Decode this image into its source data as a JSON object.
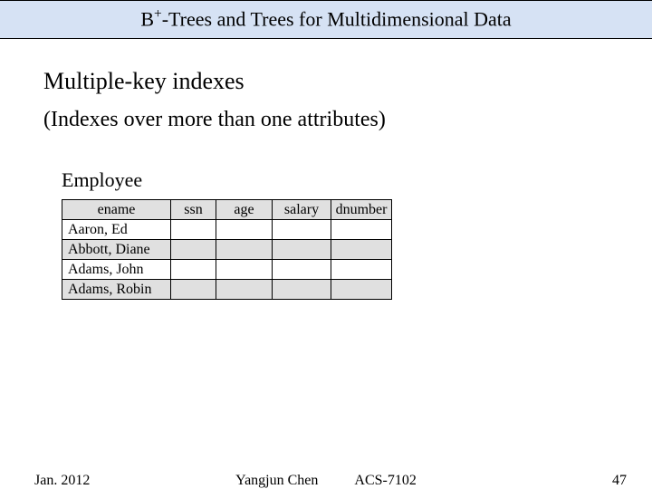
{
  "title_prefix": "B",
  "title_sup": "+",
  "title_rest": "-Trees and Trees for Multidimensional Data",
  "heading": "Multiple-key indexes",
  "subheading": "(Indexes over more than one attributes)",
  "table_label": "Employee",
  "columns": {
    "c0": "ename",
    "c1": "ssn",
    "c2": "age",
    "c3": "salary",
    "c4": "dnumber"
  },
  "rows": [
    {
      "ename": "Aaron, Ed",
      "ssn": "",
      "age": "",
      "salary": "",
      "dnumber": ""
    },
    {
      "ename": "Abbott, Diane",
      "ssn": "",
      "age": "",
      "salary": "",
      "dnumber": ""
    },
    {
      "ename": "Adams, John",
      "ssn": "",
      "age": "",
      "salary": "",
      "dnumber": ""
    },
    {
      "ename": "Adams, Robin",
      "ssn": "",
      "age": "",
      "salary": "",
      "dnumber": ""
    }
  ],
  "footer": {
    "date": "Jan. 2012",
    "author": "Yangjun Chen",
    "course": "ACS-7102",
    "page": "47"
  }
}
